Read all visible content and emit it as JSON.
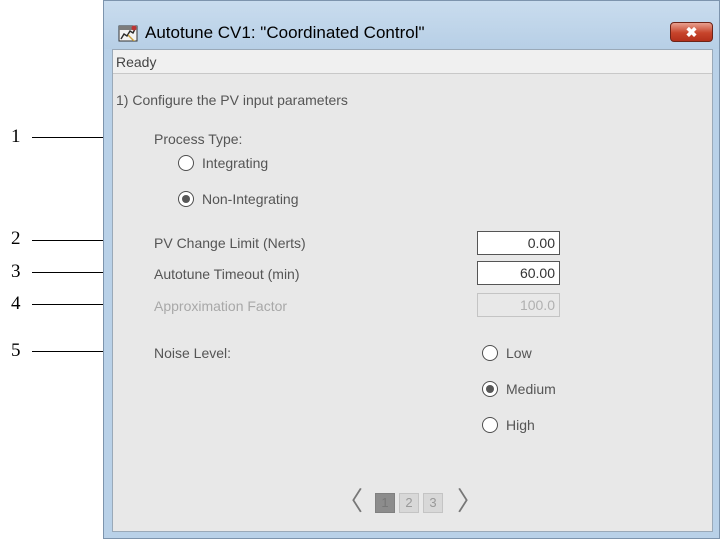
{
  "window": {
    "title": "Autotune CV1:  \"Coordinated Control\"",
    "close_label": "✖",
    "status": "Ready"
  },
  "step": "1) Configure the PV input parameters",
  "process_type": {
    "label": "Process Type:",
    "options": [
      {
        "label": "Integrating",
        "selected": false
      },
      {
        "label": "Non-Integrating",
        "selected": true
      }
    ]
  },
  "pv_change_limit": {
    "label": "PV Change Limit (Nerts)",
    "value": "0.00"
  },
  "autotune_timeout": {
    "label": "Autotune Timeout (min)",
    "value": "60.00"
  },
  "approximation_factor": {
    "label": "Approximation Factor",
    "value": "100.0",
    "enabled": false
  },
  "noise_level": {
    "label": "Noise Level:",
    "options": [
      {
        "label": "Low",
        "selected": false
      },
      {
        "label": "Medium",
        "selected": true
      },
      {
        "label": "High",
        "selected": false
      }
    ]
  },
  "pager": {
    "prev": "〈",
    "next": "〉",
    "pages": [
      "1",
      "2",
      "3"
    ],
    "current": 1
  },
  "callouts": [
    "1",
    "2",
    "3",
    "4",
    "5"
  ],
  "colors": {
    "frame": "#b9d1e8",
    "client": "#e8e8e8",
    "close_button": "#c7442b"
  }
}
